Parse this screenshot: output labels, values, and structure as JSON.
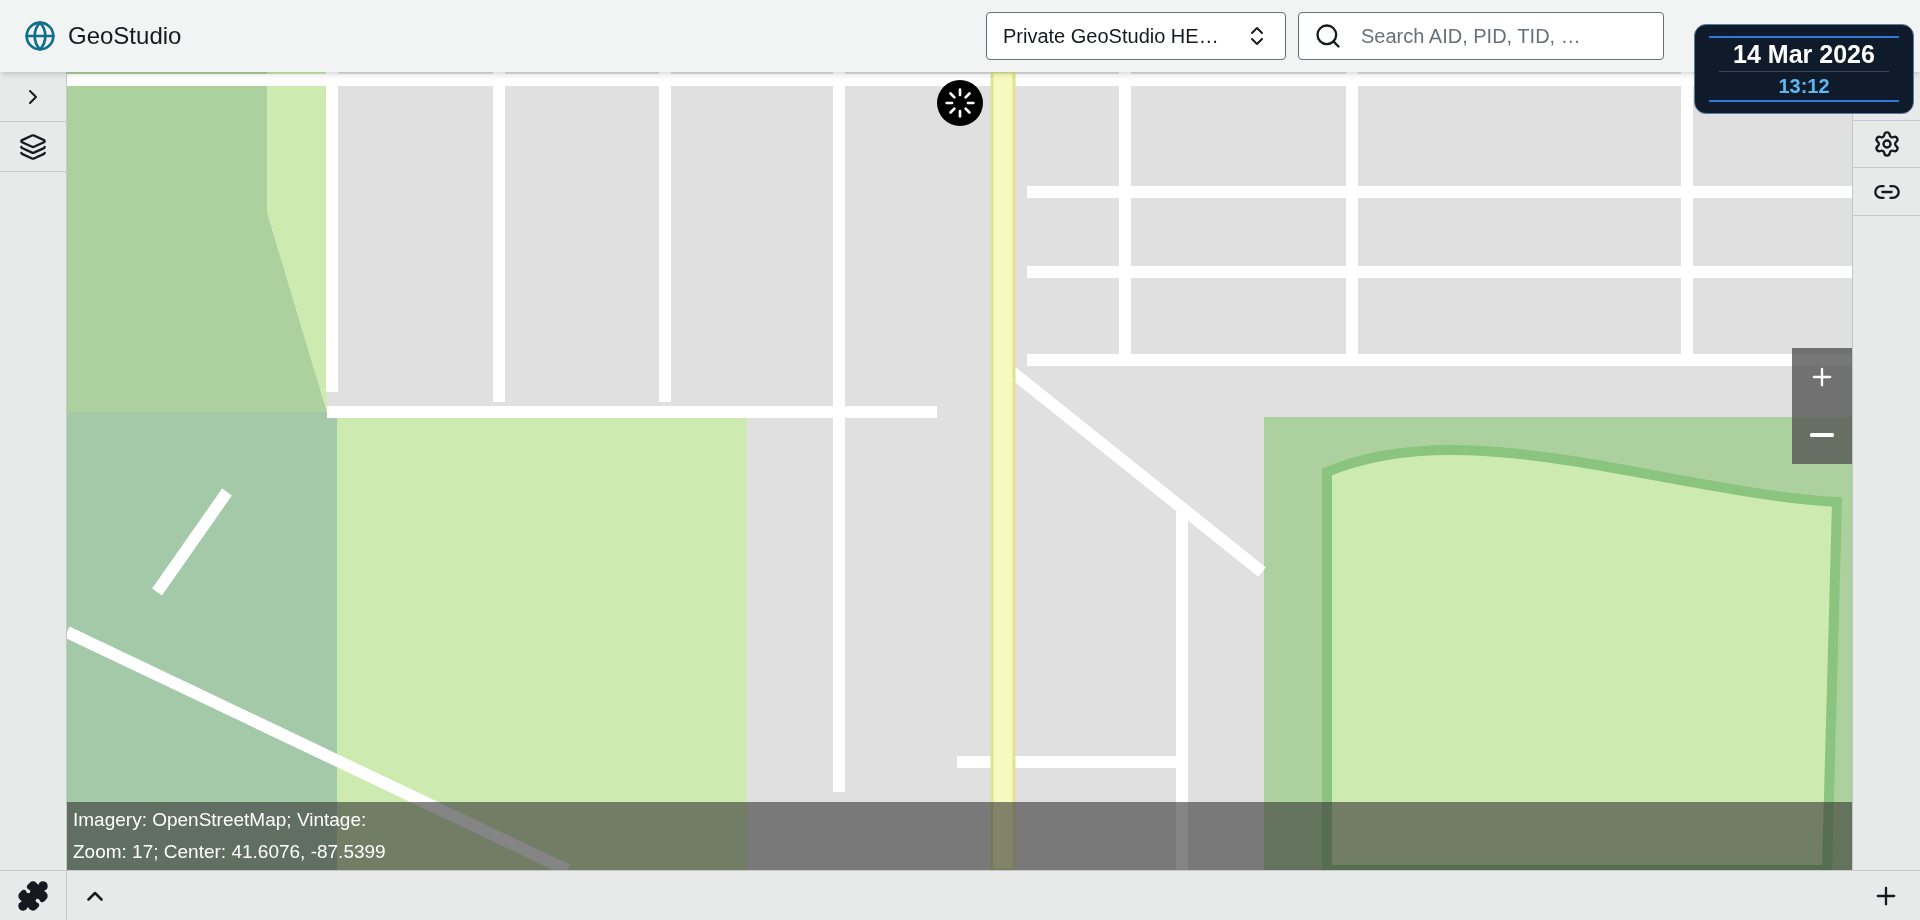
{
  "app": {
    "title": "GeoStudio"
  },
  "workspace_select": {
    "value": "Private GeoStudio HE…"
  },
  "search": {
    "placeholder": "Search AID, PID, TID, …"
  },
  "datetime": {
    "date": "14 Mar 2026",
    "time": "13:12"
  },
  "map": {
    "loading": true,
    "attribution": [
      "Imagery: OpenStreetMap; Vintage:",
      "Zoom: 17; Center: 41.6076, -87.5399"
    ]
  }
}
